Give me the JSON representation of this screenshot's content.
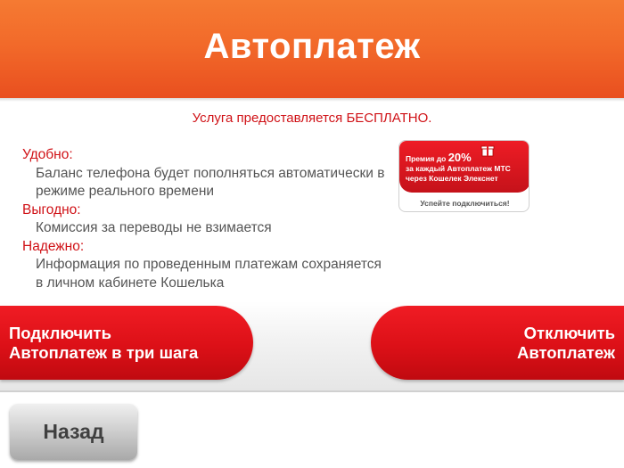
{
  "header": {
    "title": "Автоплатеж"
  },
  "free_note": "Услуга предоставляется БЕСПЛАТНО.",
  "features": [
    {
      "title": "Удобно:",
      "lines": [
        "Баланс телефона будет пополняться автоматически в",
        "режиме реального времени"
      ]
    },
    {
      "title": "Выгодно:",
      "lines": [
        "Комиссия за переводы не взимается"
      ]
    },
    {
      "title": "Надежно:",
      "lines": [
        "Информация по проведенным платежам сохраняется",
        "в личном кабинете Кошелька"
      ]
    }
  ],
  "promo": {
    "line1_prefix": "Премия до ",
    "percent": "20%",
    "line2": "за каждый Автоплатеж МТС",
    "line3": "через Кошелек Элекснет",
    "footer": "Успейте подключиться!",
    "icon": "gift-icon"
  },
  "buttons": {
    "connect": [
      "Подключить",
      "Автоплатеж в три шага"
    ],
    "disconnect": [
      "Отключить",
      "Автоплатеж"
    ],
    "back": "Назад"
  },
  "colors": {
    "header_orange": "#f26a2a",
    "accent_red": "#d01217",
    "button_red": "#dc1017",
    "back_gray": "#c9c9c9"
  }
}
